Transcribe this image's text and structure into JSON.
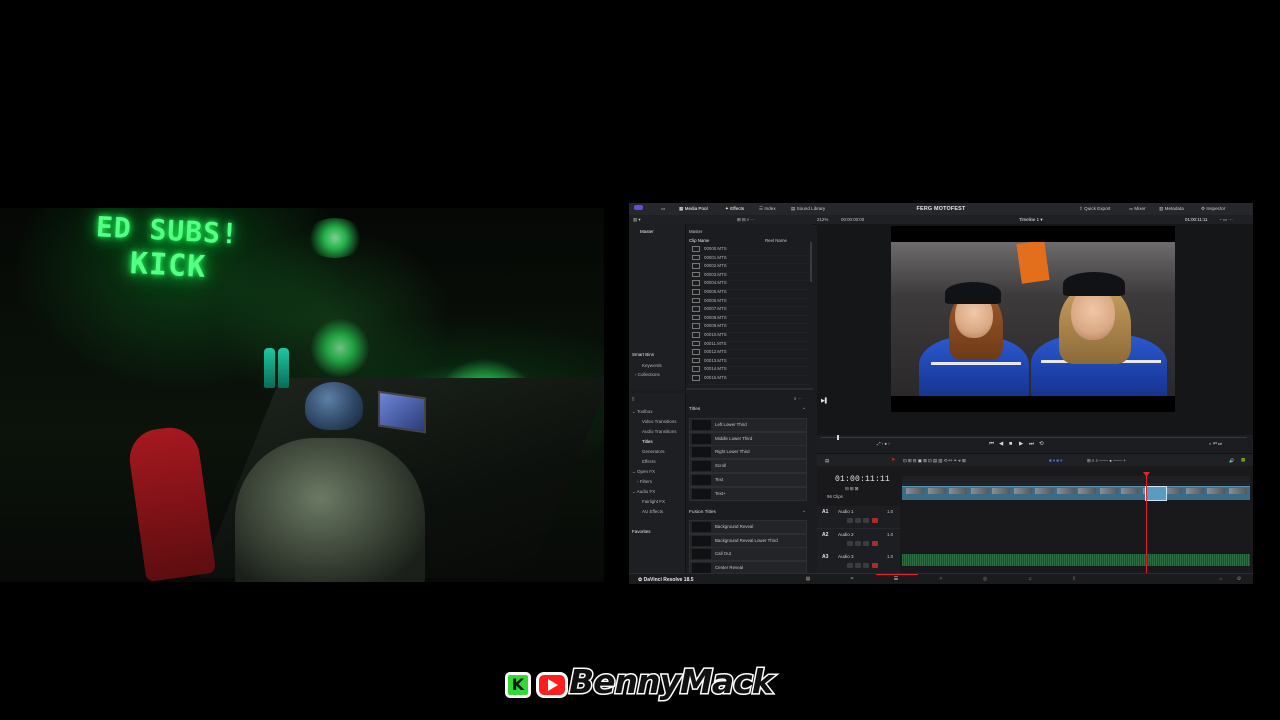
{
  "cam": {
    "neon_top": "ED SUBS!",
    "neon_bottom": "KICK"
  },
  "resolve": {
    "project_title": "FERG MOTOFEST",
    "top_tabs": [
      "Media Pool",
      "Effects",
      "Index",
      "Sound Library"
    ],
    "top_right": [
      "Quick Export",
      "Mixer",
      "Metadata",
      "Inspector"
    ],
    "zoom": "212%",
    "source_tc": "00:00:00:00",
    "timeline_name": "Timeline 1",
    "record_tc_small": "01:00:11:11",
    "bins_header": "Master",
    "smart_bins": "Smart Bins",
    "smart_items": [
      "Keywords",
      "Collections"
    ],
    "clips_header": "Master",
    "clip_col_name": "Clip Name",
    "clip_col_reel": "Reel Name",
    "clips": [
      "00000.MTS",
      "00001.MTS",
      "00002.MTS",
      "00003.MTS",
      "00004.MTS",
      "00005.MTS",
      "00006.MTS",
      "00007.MTS",
      "00008.MTS",
      "00009.MTS",
      "00010.MTS",
      "00011.MTS",
      "00012.MTS",
      "00013.MTS",
      "00014.MTS",
      "00015.MTS"
    ],
    "fx_tree": [
      "Toolbox",
      "Video Transitions",
      "Audio Transitions",
      "Titles",
      "Generators",
      "Effects",
      "Open FX",
      "Filters",
      "Audio FX",
      "Fairlight FX",
      "AU Effects"
    ],
    "favorites": "Favorites",
    "titles_section": "Titles",
    "titles": [
      "Left Lower Third",
      "Middle Lower Third",
      "Right Lower Third",
      "Scroll",
      "Text",
      "Text+"
    ],
    "fusion_section": "Fusion Titles",
    "fusion_titles": [
      "Background Reveal",
      "Background Reveal Lower Third",
      "Call Out",
      "Center Reveal"
    ],
    "timecode": "01:00:11:11",
    "clips_count": "96 Clips",
    "tracks": [
      {
        "id": "A1",
        "name": "Audio 1",
        "level": "1.0"
      },
      {
        "id": "A2",
        "name": "Audio 2",
        "level": "1.0"
      },
      {
        "id": "A3",
        "name": "Audio 3",
        "level": "1.0"
      }
    ],
    "brand": "DaVinci Resolve 18.5"
  },
  "logo": {
    "text": "BennyMack",
    "k_letter": "K"
  },
  "colors": {
    "neon_green": "#56ff86",
    "resolve_accent": "#5b52d6",
    "playhead_red": "#e3212b",
    "youtube_red": "#ff1d1d",
    "kick_green": "#36d836"
  }
}
